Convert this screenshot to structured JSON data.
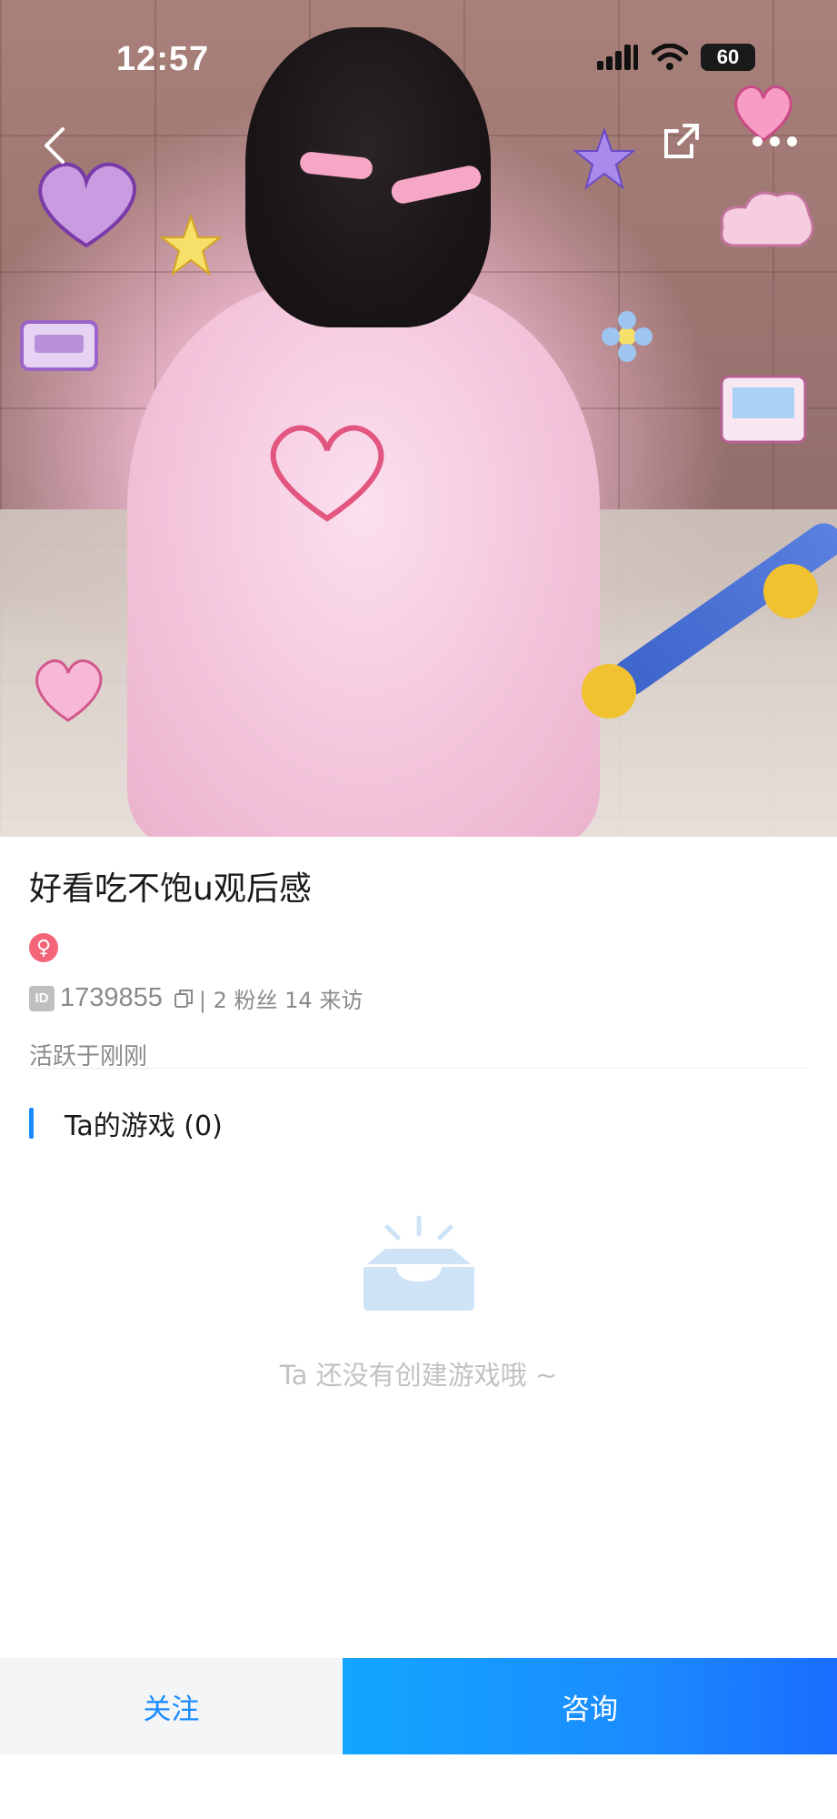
{
  "status_bar": {
    "time": "12:57",
    "battery": "60"
  },
  "top_nav": {
    "back_icon": "chevron-left-icon",
    "share_icon": "share-icon",
    "more_icon": "more-dots-icon"
  },
  "profile": {
    "nickname": "好看吃不饱u观后感",
    "gender_symbol": "♀",
    "id_tag": "ID",
    "id_value": "1739855",
    "stats": "| 2 粉丝  14 来访",
    "active": "活跃于刚刚"
  },
  "games_section": {
    "title": "Ta的游戏 (0)",
    "empty_text": "Ta 还没有创建游戏哦 ~"
  },
  "bottom_bar": {
    "follow_label": "关注",
    "consult_label": "咨询"
  },
  "colors": {
    "accent": "#1a8cff",
    "gender": "#f4657a",
    "muted": "#8a8a8a"
  }
}
